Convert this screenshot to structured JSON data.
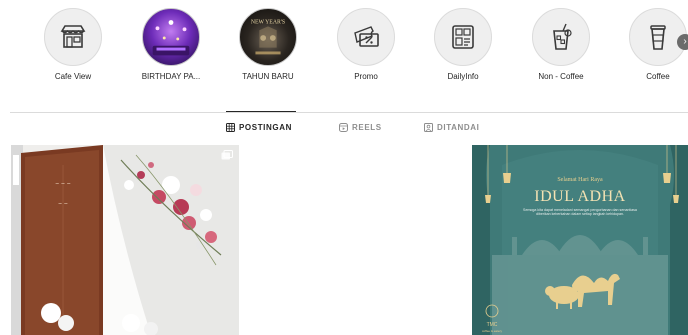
{
  "highlights": [
    {
      "label": "Cafe View",
      "icon": "storefront-icon"
    },
    {
      "label": "BIRTHDAY PA...",
      "icon": "birthday-photo"
    },
    {
      "label": "TAHUN BARU",
      "icon": "new-year-photo",
      "photo_text": "NEW YEAR'S"
    },
    {
      "label": "Promo",
      "icon": "discount-ticket-icon"
    },
    {
      "label": "DailyInfo",
      "icon": "info-board-icon"
    },
    {
      "label": "Non - Coffee",
      "icon": "iced-drink-icon"
    },
    {
      "label": "Coffee",
      "icon": "coffee-cup-icon"
    }
  ],
  "highlight_next_glyph": "›",
  "tabs": [
    {
      "label": "POSTINGAN",
      "icon": "grid-icon",
      "active": true
    },
    {
      "label": "REELS",
      "icon": "reels-icon",
      "active": false
    },
    {
      "label": "DITANDAI",
      "icon": "tagged-icon",
      "active": false
    }
  ],
  "posts": {
    "post3": {
      "greeting": "Selamat Hari Raya",
      "title": "IDUL ADHA",
      "body": "Semoga kita dapat meneladani semangat pengorbanan dan senantiasa diberikan keberkahan dalam setiap langkah kehidupan.",
      "brand": "TMC",
      "brand_sub": "coffee & eatery"
    }
  },
  "colors": {
    "eid_background": "#3f7a78",
    "eid_gold": "#e8cf8f",
    "text_primary": "#262626",
    "text_secondary": "#8e8e8e",
    "divider": "#dbdbdb"
  }
}
